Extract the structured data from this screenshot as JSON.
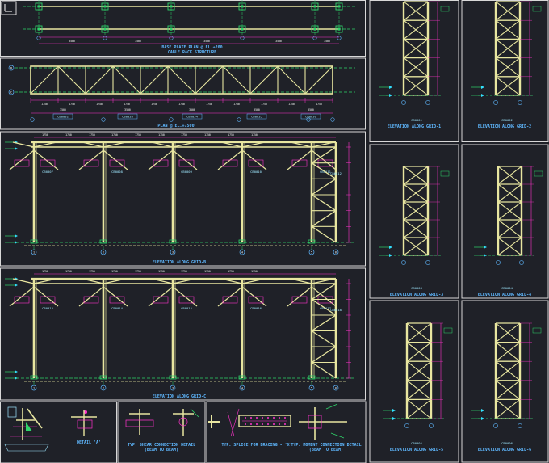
{
  "titles": {
    "base_plate": "BASE PLATE PLAN @ EL.+200",
    "base_plate_sub": "CABLE RACK STRUCTURE",
    "plan": "PLAN @ EL.+7500",
    "elev_b": "ELEVATION ALONG GRID-B",
    "elev_c": "ELEVATION ALONG GRID-C",
    "elev_1": "ELEVATION ALONG GRID-1",
    "elev_2": "ELEVATION ALONG GRID-2",
    "elev_3": "ELEVATION ALONG GRID-3",
    "elev_4": "ELEVATION ALONG GRID-4",
    "elev_5": "ELEVATION ALONG GRID-5",
    "elev_6": "ELEVATION ALONG GRID-6",
    "detail_a": "DETAIL 'A'",
    "typ_shear": "TYP. SHEAR CONNECTION DETAIL",
    "typ_shear_sub": "(BEAM TO BEAM)",
    "typ_splice": "TYP. SPLICE FOR BRACING - 'X'",
    "typ_moment": "TYP. MOMENT CONNECTION DETAIL",
    "typ_moment_sub": "(BEAM TO BEAM)"
  },
  "tags": {
    "plan_bays": [
      "CB0032",
      "CB0033",
      "CB0034",
      "CB0035",
      "CB0036"
    ],
    "col_tag_1": "CB0001",
    "col_tag_2": "CB0002",
    "col_tag_3": "CB0003",
    "col_tag_4": "CB0004",
    "col_tag_5": "CB0005",
    "col_tag_6": "CB0006",
    "elev_b_tags": [
      "CB0007",
      "CB0008",
      "CB0009",
      "CB0010",
      "CB0011",
      "CB0012"
    ],
    "elev_c_tags": [
      "CB0013",
      "CB0014",
      "CB0015",
      "CB0016",
      "CB0017",
      "CB0018"
    ]
  },
  "dims": {
    "plan_spans": [
      "1750",
      "1750",
      "1750",
      "1750",
      "1750",
      "1750",
      "1750",
      "1750",
      "1750",
      "1750",
      "1750"
    ],
    "plan_bay_spans": [
      "3500",
      "3500",
      "3500",
      "3500",
      "3500"
    ],
    "base_spans": [
      "3500",
      "3500",
      "3500",
      "3500",
      "3500"
    ],
    "elev_spans": [
      "1750",
      "1750",
      "1750",
      "1750",
      "1750",
      "1750",
      "1750",
      "1750",
      "1750",
      "1750"
    ]
  },
  "grid_labels": {
    "columns": [
      "1",
      "2",
      "3",
      "4",
      "5",
      "6"
    ],
    "rows": [
      "B",
      "C"
    ]
  },
  "colors": {
    "background": "#1f2128",
    "member": "#e8e6a0",
    "dimension": "#ff33cc",
    "gridline": "#2fd46a",
    "title": "#5fb8ff",
    "border": "#d8d8d8"
  }
}
